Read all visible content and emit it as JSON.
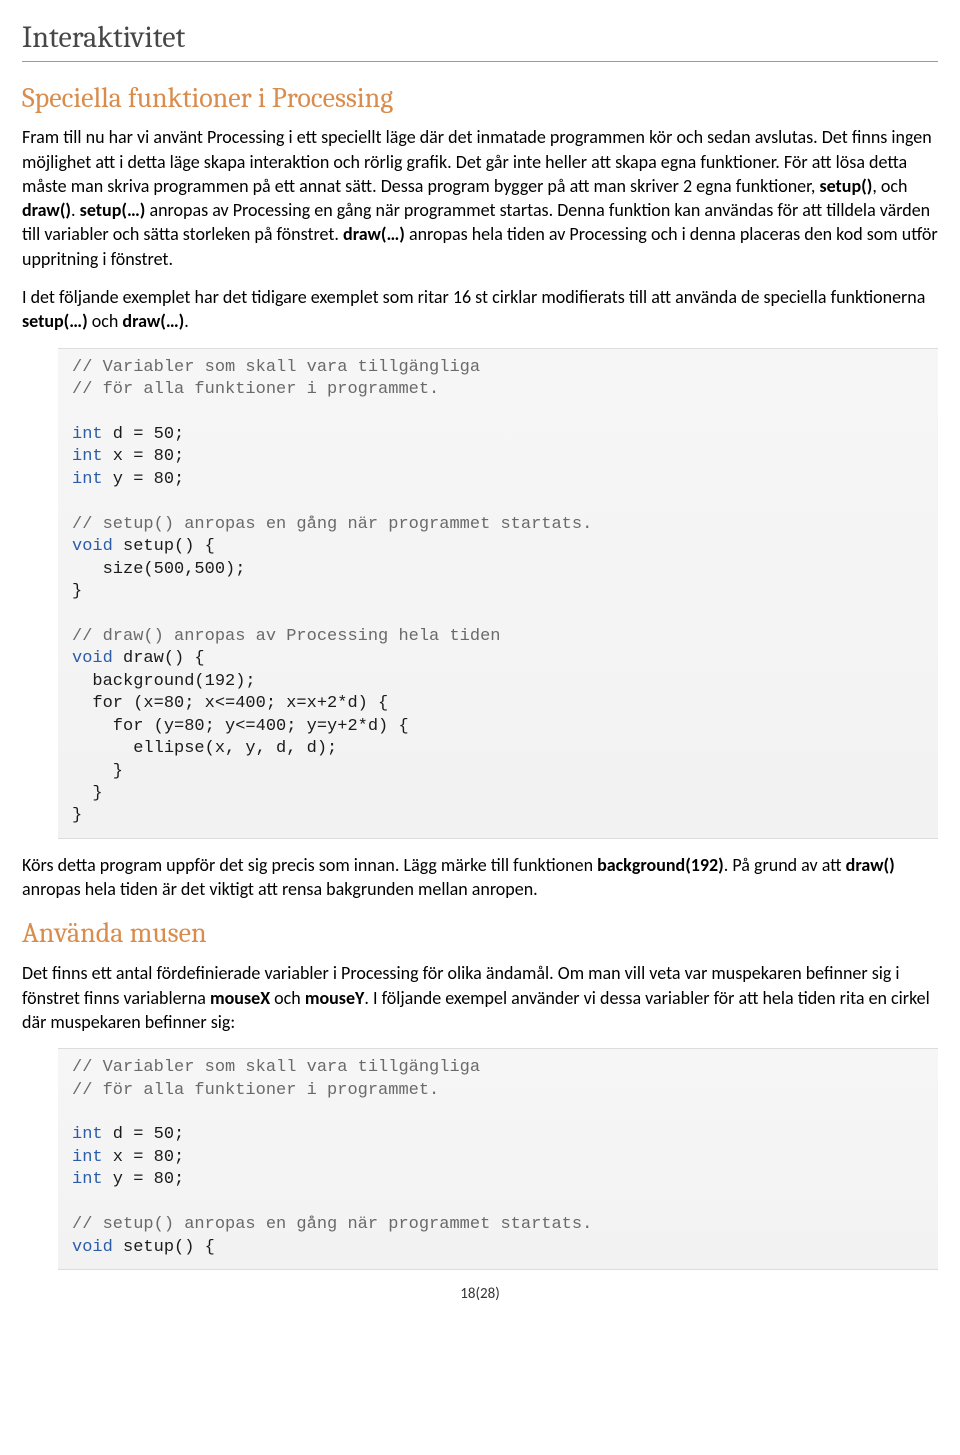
{
  "title": "Interaktivitet",
  "section1": {
    "heading": "Speciella funktioner i Processing",
    "para1_pre": "Fram till nu har vi använt Processing i ett speciellt läge där det inmatade programmen kör och sedan avslutas. Det finns ingen möjlighet att i detta läge skapa interaktion och rörlig grafik. Det går inte heller att skapa egna funktioner. För att lösa detta måste man skriva programmen på ett annat sätt. Dessa program bygger på att man skriver 2 egna funktioner, ",
    "setup_bold": "setup()",
    "para1_mid1": ", och ",
    "draw_bold": "draw()",
    "para1_mid2": ". ",
    "setup2_bold": "setup(…)",
    "para1_mid3": " anropas av Processing en gång när programmet startas. Denna funktion kan användas för att tilldela värden till variabler och sätta storleken på fönstret. ",
    "draw2_bold": "draw(…)",
    "para1_end": " anropas hela tiden av Processing och i denna placeras den kod som utför uppritning i fönstret.",
    "para2_pre": "I det följande exemplet har det tidigare exemplet som ritar 16 st cirklar modifierats till att använda de speciella funktionerna ",
    "setup3_bold": "setup(…)",
    "para2_mid": " och ",
    "draw3_bold": "draw(…)",
    "para2_end": ".",
    "code": {
      "c1": "// Variabler som skall vara tillgängliga",
      "c2": "// för alla funktioner i programmet.",
      "t_int": "int",
      "l_d": " d = 50;",
      "l_x": " x = 80;",
      "l_y": " y = 80;",
      "c3": "// setup() anropas en gång när programmet startats.",
      "t_void": "void",
      "l_setup": " setup() {",
      "l_size": "   size(500,500);",
      "brace": "}",
      "c4": "// draw() anropas av Processing hela tiden",
      "l_draw": " draw() {",
      "l_bg": "  background(192);",
      "l_for1": "  for (x=80; x<=400; x=x+2*d) {",
      "l_for2": "    for (y=80; y<=400; y=y+2*d) {",
      "l_ell": "      ellipse(x, y, d, d);",
      "l_cb3": "    }",
      "l_cb2": "  }",
      "l_cb1": "}"
    },
    "para3_pre": "Körs detta program uppför det sig precis som innan. Lägg märke till funktionen ",
    "bg_bold": "background(192)",
    "para3_mid": ". På grund av att ",
    "draw4_bold": "draw()",
    "para3_end": " anropas hela tiden är det viktigt att rensa bakgrunden mellan anropen."
  },
  "section2": {
    "heading": "Använda musen",
    "para1_pre": "Det finns ett antal fördefinierade variabler i Processing för olika ändamål. Om man vill veta var muspekaren befinner sig i fönstret finns variablerna ",
    "mx_bold": "mouseX",
    "para1_mid": " och ",
    "my_bold": "mouseY",
    "para1_end": ". I följande exempel använder vi dessa variabler för att hela tiden rita en cirkel där muspekaren befinner sig:",
    "code": {
      "c1": "// Variabler som skall vara tillgängliga",
      "c2": "// för alla funktioner i programmet.",
      "t_int": "int",
      "l_d": " d = 50;",
      "l_x": " x = 80;",
      "l_y": " y = 80;",
      "c3": "// setup() anropas en gång när programmet startats.",
      "t_void": "void",
      "l_setup": " setup() {"
    }
  },
  "footer": "18(28)"
}
